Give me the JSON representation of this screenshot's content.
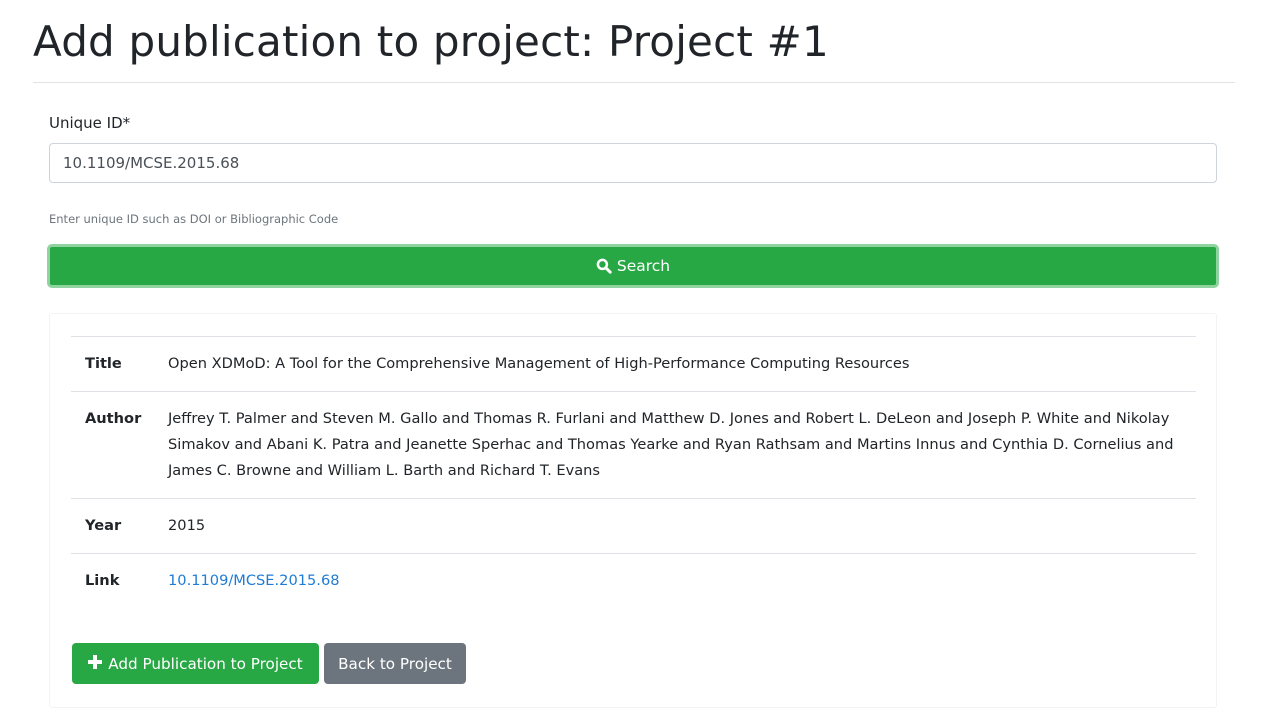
{
  "page": {
    "title": "Add publication to project: Project #1"
  },
  "form": {
    "label": "Unique ID*",
    "value": "10.1109/MCSE.2015.68",
    "help": "Enter unique ID such as DOI or Bibliographic Code",
    "search_label": "Search",
    "search_icon": "search-icon"
  },
  "publication": {
    "rows": [
      {
        "label": "Title",
        "value": "Open XDMoD: A Tool for the Comprehensive Management of High-Performance Computing Resources"
      },
      {
        "label": "Author",
        "value": "Jeffrey T. Palmer and Steven M. Gallo and Thomas R. Furlani and Matthew D. Jones and Robert L. DeLeon and Joseph P. White and Nikolay Simakov and Abani K. Patra and Jeanette Sperhac and Thomas Yearke and Ryan Rathsam and Martins Innus and Cynthia D. Cornelius and James C. Browne and William L. Barth and Richard T. Evans"
      },
      {
        "label": "Year",
        "value": "2015"
      },
      {
        "label": "Link",
        "value": "10.1109/MCSE.2015.68"
      }
    ]
  },
  "actions": {
    "add_label": "Add Publication to Project",
    "add_icon": "plus-icon",
    "back_label": "Back to Project"
  },
  "colors": {
    "primary_success": "#28a745",
    "secondary": "#6c757d",
    "link": "#1f7bd3",
    "text": "#212529"
  }
}
